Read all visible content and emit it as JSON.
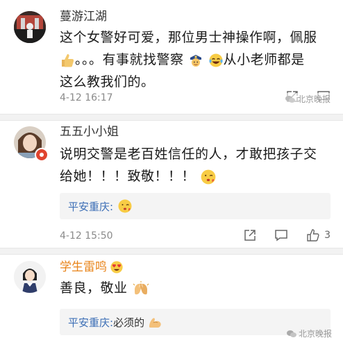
{
  "comments": [
    {
      "user": "蔓游江湖",
      "text_part1": "这个女警好可爱，那位男士神操作啊，佩服",
      "text_part2": "。。。有事就找警察",
      "text_part3": "从小老师都是",
      "text_part4": "这么教我们的。",
      "time": "4-12 16:17",
      "emojis": [
        "thumbs-up-emoji",
        "police-officer-emoji",
        "laughing-tears-emoji"
      ]
    },
    {
      "user": "五五小小姐",
      "text_line1": "说明交警是老百姓信任的人，才敢把孩子交",
      "text_line2": "给她！！！致敬！！！",
      "time": "4-12 15:50",
      "like_count": "3",
      "reply_user": "平安重庆:",
      "emojis": [
        "kissing-emoji",
        "kissing-emoji"
      ]
    },
    {
      "user": "学生雷鸣",
      "text": "善良，敬业",
      "reply_user": "平安重庆:",
      "reply_text": " 必须的",
      "emojis": [
        "heart-eyes-emoji",
        "applause-emoji",
        "flexed-arm-emoji"
      ]
    }
  ],
  "watermark": "北京晚报",
  "colors": {
    "link_blue": "#3d6fb6",
    "name_orange": "#e8841a",
    "meta_grey": "#8a8a8a",
    "separator": "#f2f2f2"
  }
}
